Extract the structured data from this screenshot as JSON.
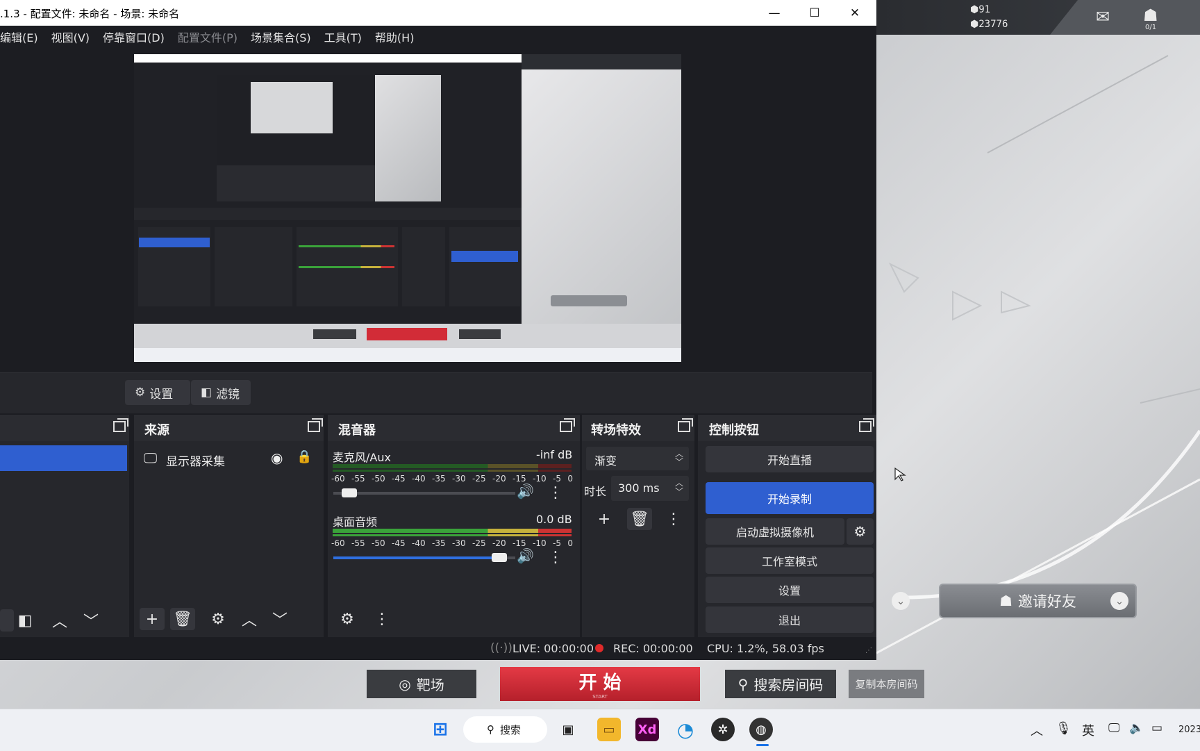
{
  "window": {
    "title": ".1.3 - 配置文件: 未命名 - 场景: 未命名",
    "minimize": "—",
    "maximize": "☐",
    "close": "✕"
  },
  "menu": {
    "items": [
      "编辑(E)",
      "视图(V)",
      "停靠窗口(D)",
      "配置文件(P)",
      "场景集合(S)",
      "工具(T)",
      "帮助(H)"
    ]
  },
  "scene_toolbar": {
    "settings": "设置",
    "filters": "滤镜"
  },
  "sources": {
    "title": "来源",
    "items": [
      {
        "label": "显示器采集"
      }
    ]
  },
  "mixer": {
    "title": "混音器",
    "channels": [
      {
        "name": "麦克风/Aux",
        "level": "-inf dB",
        "volume": 0.05
      },
      {
        "name": "桌面音频",
        "level": "0.0 dB",
        "volume": 0.95
      }
    ],
    "ticks": [
      "-60",
      "-55",
      "-50",
      "-45",
      "-40",
      "-35",
      "-30",
      "-25",
      "-20",
      "-15",
      "-10",
      "-5",
      "0"
    ]
  },
  "transitions": {
    "title": "转场特效",
    "type": "渐变",
    "duration_label": "时长",
    "duration_value": "300 ms"
  },
  "controls": {
    "title": "控制按钮",
    "start_stream": "开始直播",
    "start_record": "开始录制",
    "virtual_cam": "启动虚拟摄像机",
    "studio_mode": "工作室模式",
    "settings": "设置",
    "exit": "退出"
  },
  "status": {
    "live": "LIVE: 00:00:00",
    "rec": "REC: 00:00:00",
    "cpu": "CPU: 1.2%, 58.03 fps"
  },
  "game": {
    "coins": "91",
    "gems": "23776",
    "profile_count": "0/1",
    "invite": "邀请好友",
    "range": "靶场",
    "start": "开 始",
    "start_sub": "START",
    "search_room": "搜索房间码",
    "copy_room": "复制本房间码"
  },
  "taskbar": {
    "search": "搜索",
    "ime": "英",
    "clock": "2023",
    "apps": [
      "start-icon",
      "search",
      "task-view-icon",
      "file-explorer-icon",
      "adobe-xd-icon",
      "edge-icon",
      "game-app-icon",
      "obs-icon"
    ]
  },
  "colors": {
    "accent_blue": "#2f5fd0",
    "rec_red": "#e02a2a",
    "start_red": "#d22c37",
    "obs_bg": "#1c1d22",
    "dock_bg": "#26272c"
  }
}
